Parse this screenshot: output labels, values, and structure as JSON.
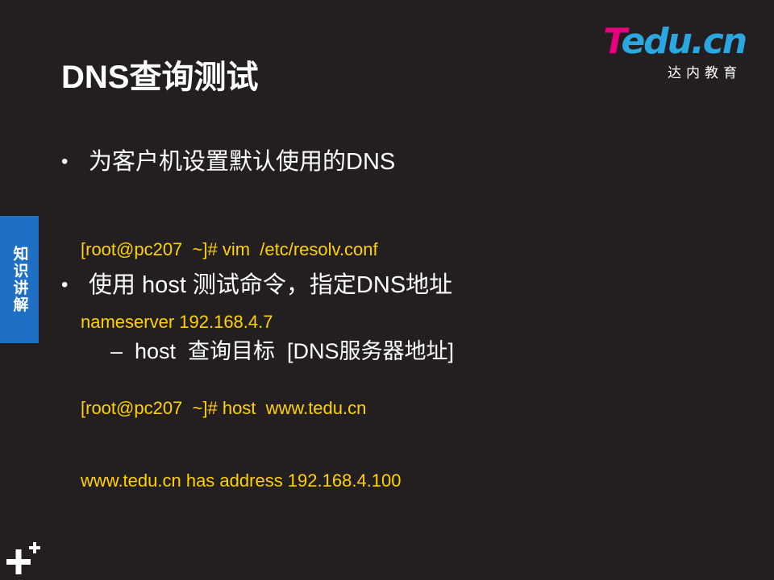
{
  "logo": {
    "brand_t": "T",
    "brand_rest": "edu.cn",
    "subtitle": "达内教育"
  },
  "slide": {
    "title": "DNS查询测试",
    "side_tab": "知识讲解",
    "bullet1": "为客户机设置默认使用的DNS",
    "code1": [
      "[root@pc207  ~]# vim  /etc/resolv.conf",
      "nameserver 192.168.4.7"
    ],
    "bullet2": "使用 host 测试命令，指定DNS地址",
    "sub_bullet": "host  查询目标  [DNS服务器地址]",
    "code2": [
      "[root@pc207  ~]# host  www.tedu.cn",
      "www.tedu.cn has address 192.168.4.100"
    ]
  },
  "symbols": {
    "bullet": "•",
    "dash": "–"
  },
  "colors": {
    "background": "#231f20",
    "code_text": "#ffd200",
    "side_tab": "#1f6fc5",
    "logo_pink": "#e6007e",
    "logo_blue": "#2aa7e0"
  },
  "icons": {
    "corner": "plus-cross-icon"
  }
}
